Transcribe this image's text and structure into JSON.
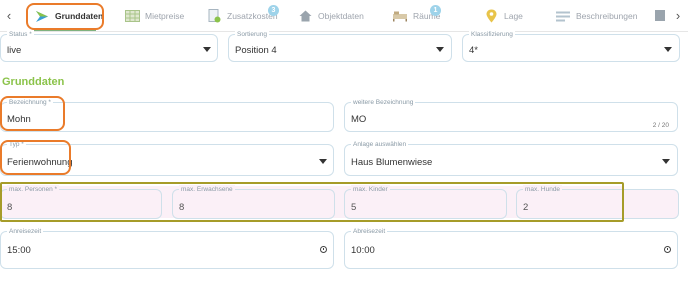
{
  "tabs": [
    {
      "label": "Grunddaten",
      "icon": "arrow-logo-icon",
      "active": true
    },
    {
      "label": "Mietpreise",
      "icon": "table-grid-icon"
    },
    {
      "label": "Zusatzkosten",
      "icon": "document-cost-icon",
      "badge": "3"
    },
    {
      "label": "Objektdaten",
      "icon": "house-icon"
    },
    {
      "label": "Räume",
      "icon": "bed-icon",
      "badge": "1"
    },
    {
      "label": "Lage",
      "icon": "map-pin-icon"
    },
    {
      "label": "Beschreibungen",
      "icon": "text-lines-icon"
    }
  ],
  "nav": {
    "prev": "‹",
    "next": "›"
  },
  "top_fields": {
    "status": {
      "label": "Status *",
      "value": "live"
    },
    "sortierung": {
      "label": "Sortierung",
      "value": "Position 4"
    },
    "klassifizierung": {
      "label": "Klassifizierung",
      "value": "4*"
    }
  },
  "section_title": "Grunddaten",
  "bezeichnung": {
    "label": "Bezeichnung *",
    "value": "Mohn"
  },
  "weitere_bezeichnung": {
    "label": "weitere Bezeichnung",
    "value": "MO",
    "counter": "2 / 20"
  },
  "typ": {
    "label": "Typ *",
    "value": "Ferienwohnung"
  },
  "anlage": {
    "label": "Anlage auswählen",
    "value": "Haus Blumenwiese"
  },
  "capacity": {
    "personen": {
      "label": "max. Personen *",
      "value": "8"
    },
    "erwachsene": {
      "label": "max. Erwachsene",
      "value": "8"
    },
    "kinder": {
      "label": "max. Kinder",
      "value": "5"
    },
    "hunde": {
      "label": "max. Hunde",
      "value": "2"
    }
  },
  "anreise": {
    "label": "Anreisezeit",
    "value": "15:00"
  },
  "abreise": {
    "label": "Abreisezeit",
    "value": "10:00"
  },
  "colors": {
    "accent_green": "#8bc34a",
    "highlight_orange": "#ea7b2a",
    "highlight_olive": "#a69c29",
    "badge_blue": "#9ed3ea"
  }
}
